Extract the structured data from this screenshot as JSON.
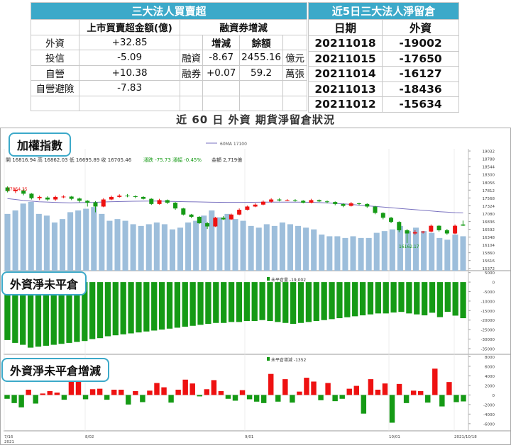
{
  "table1": {
    "title": "三大法人買賣超",
    "col_amount": "上市買賣超金額(億)",
    "col_margin": "融資券增減",
    "col_change": "增減",
    "col_balance": "餘額",
    "rows": [
      {
        "name": "外資",
        "amount": "+32.85",
        "m_label": "",
        "change": "",
        "balance": "",
        "unit": ""
      },
      {
        "name": "投信",
        "amount": "-5.09",
        "m_label": "融資",
        "change": "-8.67",
        "balance": "2455.16",
        "unit": "億元"
      },
      {
        "name": "自營",
        "amount": "+10.38",
        "m_label": "融券",
        "change": "+0.07",
        "balance": "59.2",
        "unit": "萬張"
      },
      {
        "name": "自營避險",
        "amount": "-7.83",
        "m_label": "",
        "change": "",
        "balance": "",
        "unit": ""
      },
      {
        "name": "",
        "amount": "",
        "m_label": "",
        "change": "",
        "balance": "",
        "unit": ""
      }
    ]
  },
  "table2": {
    "title": "近5日三大法人淨留倉",
    "col_date": "日期",
    "col_foreign": "外資",
    "rows": [
      {
        "date": "20211018",
        "value": "-19002"
      },
      {
        "date": "20211015",
        "value": "-17650"
      },
      {
        "date": "20211014",
        "value": "-16127"
      },
      {
        "date": "20211013",
        "value": "-18436"
      },
      {
        "date": "20211012",
        "value": "-15634"
      }
    ]
  },
  "subtitle": "近 60 日 外資 期貨淨留倉狀況",
  "panel_labels": {
    "index": "加權指數",
    "net_oi": "外資淨未平倉",
    "net_oi_change": "外資淨未平倉增減"
  },
  "info": {
    "ma_legend": "60MA 17100",
    "ohlc": "開 16816.94  高 16862.03  低 16695.89  收 16705.46",
    "change": "漲跌 -75.73  漲幅 -0.45%",
    "amount": "金額 2,719億",
    "oi_legend": "未平倉量 -19,002",
    "oi_change_legend": "未平倉增減 -1352",
    "max_label": "17854.35",
    "min_label": "16162.17"
  },
  "colors": {
    "header": "#3ca9c9",
    "up": "#ee1111",
    "down": "#159a15",
    "volume": "#9dbedb",
    "ma": "#7a72c0"
  },
  "chart_data": [
    {
      "type": "candlestick",
      "title": "加權指數",
      "y_ticks": [
        19032,
        18788,
        18544,
        18300,
        18056,
        17812,
        17568,
        17324,
        17080,
        16836,
        16592,
        16348,
        16104,
        15860,
        15616,
        15372
      ],
      "x_ticks": [
        "7/16 2021",
        "8/02",
        "9/01",
        "10/01",
        "2021/10/18"
      ],
      "ma60": [
        17550,
        17520,
        17490,
        17470,
        17450,
        17440,
        17430,
        17420,
        17415,
        17420,
        17425,
        17430,
        17440,
        17450,
        17455,
        17460,
        17465,
        17468,
        17470,
        17470,
        17465,
        17460,
        17455,
        17450,
        17445,
        17440,
        17435,
        17432,
        17430,
        17430,
        17430,
        17432,
        17434,
        17436,
        17437,
        17438,
        17438,
        17436,
        17434,
        17430,
        17420,
        17410,
        17395,
        17380,
        17360,
        17340,
        17320,
        17300,
        17280,
        17260,
        17240,
        17220,
        17200,
        17180,
        17160,
        17140,
        17125,
        17110,
        17100
      ],
      "candles": [
        [
          17896,
          17780,
          17930,
          17740
        ],
        [
          17780,
          17820,
          17860,
          17720
        ],
        [
          17800,
          17700,
          17840,
          17650
        ],
        [
          17700,
          17560,
          17720,
          17520
        ],
        [
          17560,
          17600,
          17640,
          17500
        ],
        [
          17580,
          17520,
          17620,
          17480
        ],
        [
          17520,
          17600,
          17640,
          17480
        ],
        [
          17600,
          17610,
          17650,
          17560
        ],
        [
          17610,
          17540,
          17630,
          17500
        ],
        [
          17550,
          17480,
          17580,
          17430
        ],
        [
          17480,
          17420,
          17500,
          17300
        ],
        [
          17430,
          17300,
          17470,
          17120
        ],
        [
          17300,
          17520,
          17560,
          17280
        ],
        [
          17520,
          17600,
          17640,
          17500
        ],
        [
          17600,
          17640,
          17680,
          17580
        ],
        [
          17640,
          17620,
          17690,
          17590
        ],
        [
          17620,
          17600,
          17650,
          17560
        ],
        [
          17600,
          17540,
          17620,
          17520
        ],
        [
          17540,
          17380,
          17560,
          17350
        ],
        [
          17380,
          17500,
          17540,
          17360
        ],
        [
          17500,
          17420,
          17520,
          17380
        ],
        [
          17420,
          17240,
          17440,
          17200
        ],
        [
          17240,
          17050,
          17260,
          17020
        ],
        [
          17050,
          16980,
          17070,
          16940
        ],
        [
          16980,
          16780,
          17000,
          16760
        ],
        [
          16780,
          16680,
          16820,
          16600
        ],
        [
          16680,
          16950,
          16980,
          16660
        ],
        [
          16950,
          16900,
          17000,
          16880
        ],
        [
          16900,
          17050,
          17080,
          16880
        ],
        [
          17050,
          17200,
          17240,
          17030
        ],
        [
          17200,
          17300,
          17330,
          17180
        ],
        [
          17300,
          17360,
          17400,
          17280
        ],
        [
          17360,
          17450,
          17490,
          17340
        ],
        [
          17450,
          17520,
          17560,
          17420
        ],
        [
          17520,
          17490,
          17560,
          17460
        ],
        [
          17490,
          17500,
          17530,
          17470
        ],
        [
          17500,
          17480,
          17530,
          17450
        ],
        [
          17480,
          17420,
          17500,
          17400
        ],
        [
          17420,
          17500,
          17540,
          17400
        ],
        [
          17500,
          17460,
          17520,
          17440
        ],
        [
          17460,
          17440,
          17490,
          17400
        ],
        [
          17440,
          17380,
          17460,
          17340
        ],
        [
          17380,
          17320,
          17400,
          17280
        ],
        [
          17320,
          17400,
          17440,
          17300
        ],
        [
          17400,
          17380,
          17420,
          17340
        ],
        [
          17380,
          17300,
          17400,
          17260
        ],
        [
          17300,
          17100,
          17320,
          17060
        ],
        [
          17100,
          16950,
          17120,
          16900
        ],
        [
          16950,
          16820,
          16980,
          16780
        ],
        [
          16820,
          16560,
          16840,
          16500
        ],
        [
          16560,
          16460,
          16600,
          16162
        ],
        [
          16460,
          16500,
          16560,
          16420
        ],
        [
          16500,
          16520,
          16540,
          16460
        ],
        [
          16520,
          16700,
          16740,
          16500
        ],
        [
          16700,
          16560,
          16720,
          16520
        ],
        [
          16560,
          16460,
          16600,
          16420
        ],
        [
          16460,
          16700,
          16740,
          16440
        ],
        [
          16740,
          16705,
          16862,
          16695
        ]
      ],
      "volume": [
        3300,
        3500,
        3900,
        4000,
        3300,
        3200,
        2800,
        3000,
        3400,
        3500,
        3600,
        3700,
        3300,
        2900,
        3000,
        2900,
        2700,
        2600,
        2700,
        2800,
        2700,
        2400,
        2500,
        2800,
        2900,
        3200,
        3500,
        3100,
        3300,
        3000,
        2900,
        2600,
        2500,
        2700,
        2600,
        2800,
        2700,
        2600,
        2500,
        2400,
        2100,
        2000,
        2000,
        1900,
        2000,
        1900,
        1900,
        2200,
        2300,
        2400,
        2600,
        2300,
        2500,
        2300,
        2200,
        1900,
        1800,
        2100,
        2000
      ]
    },
    {
      "type": "bar",
      "title": "外資淨未平倉",
      "series": [
        {
          "name": "未平倉量",
          "values": [
            -30500,
            -32000,
            -33000,
            -34500,
            -34000,
            -33500,
            -33000,
            -32500,
            -32000,
            -31500,
            -31000,
            -30000,
            -29500,
            -28500,
            -28000,
            -27500,
            -27000,
            -26500,
            -26000,
            -25500,
            -25000,
            -24500,
            -24000,
            -23500,
            -23000,
            -22500,
            -22000,
            -21500,
            -21500,
            -21000,
            -21000,
            -20500,
            -20500,
            -20000,
            -20500,
            -21000,
            -21500,
            -22000,
            -21500,
            -21000,
            -20500,
            -20000,
            -19500,
            -19000,
            -18500,
            -18000,
            -17500,
            -17000,
            -16500,
            -16500,
            -16000,
            -15700,
            -16500,
            -17000,
            -17500,
            -16127,
            -18436,
            -15634,
            -17650,
            -19002
          ]
        }
      ],
      "y_ticks": [
        5000,
        0,
        -5000,
        -10000,
        -15000,
        -20000,
        -25000,
        -30000,
        -35000
      ],
      "ylim": [
        -38000,
        6000
      ]
    },
    {
      "type": "bar",
      "title": "外資淨未平倉增減",
      "series": [
        {
          "name": "未平倉增減",
          "values": [
            -800,
            -1700,
            -2600,
            1100,
            -1800,
            300,
            800,
            500,
            -1000,
            3200,
            3000,
            -900,
            1200,
            1300,
            -1000,
            1100,
            1100,
            -2000,
            800,
            -1500,
            900,
            2500,
            1600,
            -1600,
            1100,
            3200,
            2400,
            -300,
            1200,
            3100,
            800,
            -800,
            -1200,
            1000,
            -900,
            -1400,
            -1700,
            4400,
            -1400,
            3300,
            -1600,
            700,
            3600,
            2800,
            -1100,
            2500,
            -1300,
            -800,
            1300,
            1900,
            -3900,
            3300,
            1100,
            2400,
            -5800,
            2300,
            -1700,
            900,
            800,
            -1600,
            5500,
            -2400,
            2700,
            -1500,
            -1352
          ]
        }
      ],
      "y_ticks": [
        8000,
        6000,
        4000,
        2000,
        0,
        -2000,
        -4000,
        -6000
      ],
      "ylim": [
        -7500,
        8500
      ]
    }
  ]
}
